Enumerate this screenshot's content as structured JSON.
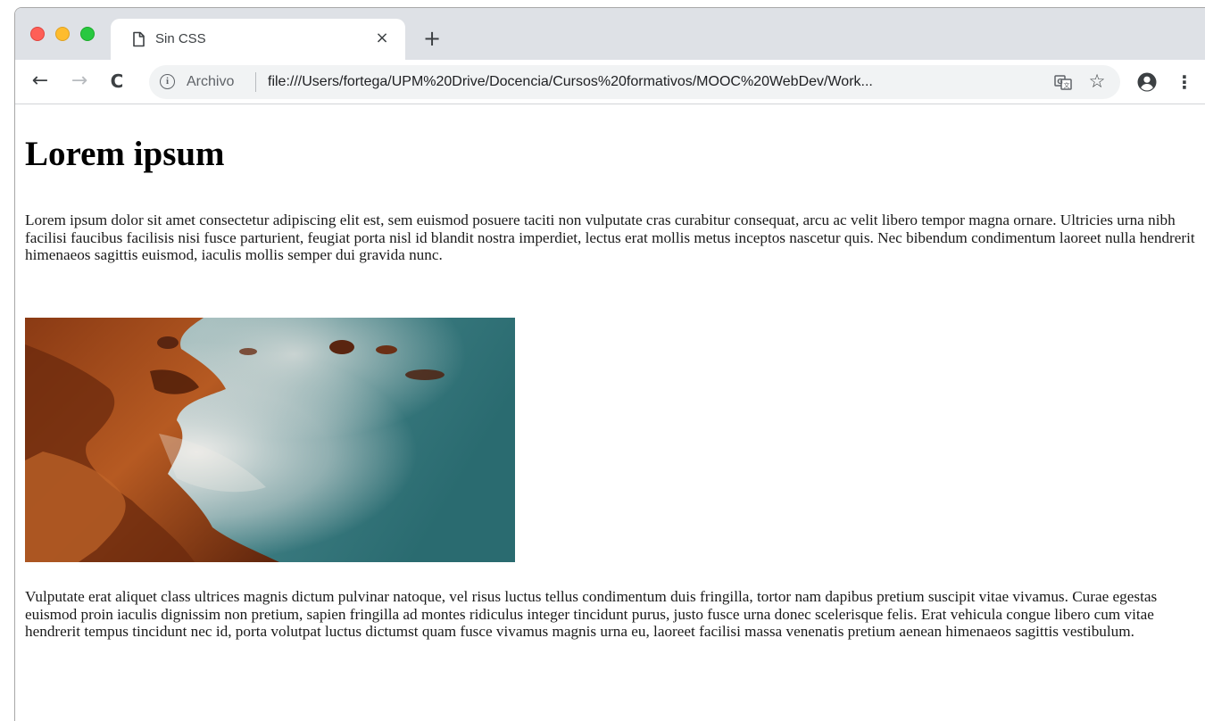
{
  "browser": {
    "tab": {
      "title": "Sin CSS",
      "close_glyph": "×",
      "icon": "document-icon"
    },
    "new_tab_glyph": "+",
    "nav": {
      "back_glyph": "←",
      "forward_glyph": "→",
      "reload_glyph": "C"
    },
    "address_bar": {
      "info_glyph": "i",
      "scheme_label": "Archivo",
      "url": "file:///Users/fortega/UPM%20Drive/Docencia/Cursos%20formativos/MOOC%20WebDev/Work..."
    },
    "star_glyph": "☆",
    "menu_glyph": "⋮"
  },
  "page": {
    "heading": "Lorem ipsum",
    "paragraph1": "Lorem ipsum dolor sit amet consectetur adipiscing elit est, sem euismod posuere taciti non vulputate cras curabitur consequat, arcu ac velit libero tempor magna ornare. Ultricies urna nibh facilisi faucibus facilisis nisi fusce parturient, feugiat porta nisl id blandit nostra imperdiet, lectus erat mollis metus inceptos nascetur quis. Nec bibendum condimentum laoreet nulla hendrerit himenaeos sagittis euismod, iaculis mollis semper dui gravida nunc.",
    "image": "rocky-coast-long-exposure-photo",
    "paragraph2": "Vulputate erat aliquet class ultrices magnis dictum pulvinar natoque, vel risus luctus tellus condimentum duis fringilla, tortor nam dapibus pretium suscipit vitae vivamus. Curae egestas euismod proin iaculis dignissim non pretium, sapien fringilla ad montes ridiculus integer tincidunt purus, justo fusce urna donec scelerisque felis. Erat vehicula congue libero cum vitae hendrerit tempus tincidunt nec id, porta volutpat luctus dictumst quam fusce vivamus magnis urna eu, laoreet facilisi massa venenatis pretium aenean himenaeos sagittis vestibulum."
  },
  "colors": {
    "titlebar": "#dee1e6",
    "omnibox": "#f1f3f4",
    "traffic_red": "#fe5f57",
    "traffic_yellow": "#febc2e",
    "traffic_green": "#28c840"
  }
}
